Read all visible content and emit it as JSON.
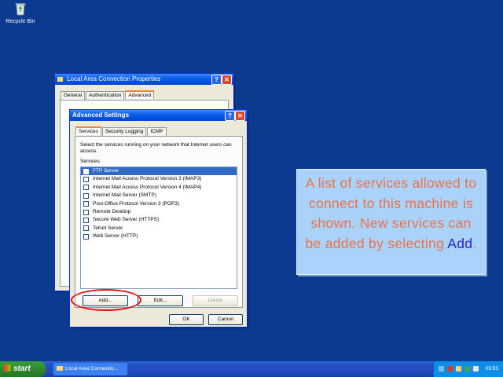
{
  "desktop": {
    "recycle_bin_label": "Recycle Bin"
  },
  "back_window": {
    "title": "Local Area Connection Properties",
    "tabs": [
      "General",
      "Authentication",
      "Advanced"
    ]
  },
  "front_window": {
    "title": "Advanced Settings",
    "tabs": [
      "Services",
      "Security Logging",
      "ICMP"
    ],
    "description": "Select the services running on your network that Internet users can access.",
    "services_label": "Services",
    "services": [
      {
        "name": "FTP Server",
        "selected": true
      },
      {
        "name": "Internet Mail Access Protocol Version 3 (IMAP3)",
        "selected": false
      },
      {
        "name": "Internet Mail Access Protocol Version 4 (IMAP4)",
        "selected": false
      },
      {
        "name": "Internet Mail Server (SMTP)",
        "selected": false
      },
      {
        "name": "Post-Office Protocol Version 3 (POP3)",
        "selected": false
      },
      {
        "name": "Remote Desktop",
        "selected": false
      },
      {
        "name": "Secure Web Server (HTTPS)",
        "selected": false
      },
      {
        "name": "Telnet Server",
        "selected": false
      },
      {
        "name": "Web Server (HTTP)",
        "selected": false
      }
    ],
    "add_label": "Add...",
    "edit_label": "Edit...",
    "delete_label": "Delete",
    "ok_label": "OK",
    "cancel_label": "Cancel"
  },
  "callout": {
    "text": "A list of services allowed to connect to this machine is shown. New services can be added by selecting ",
    "emphasis": "Add",
    "suffix": "."
  },
  "taskbar": {
    "start_label": "start",
    "task_label": "Local Area Connectio...",
    "clock": "05:55"
  },
  "colors": {
    "desktop": "#0b3a8e",
    "callout_bg": "#a9d3fb",
    "callout_text": "#ef6f4a",
    "callout_emphasis": "#2a1fd6",
    "highlight_ring": "#e01010"
  }
}
